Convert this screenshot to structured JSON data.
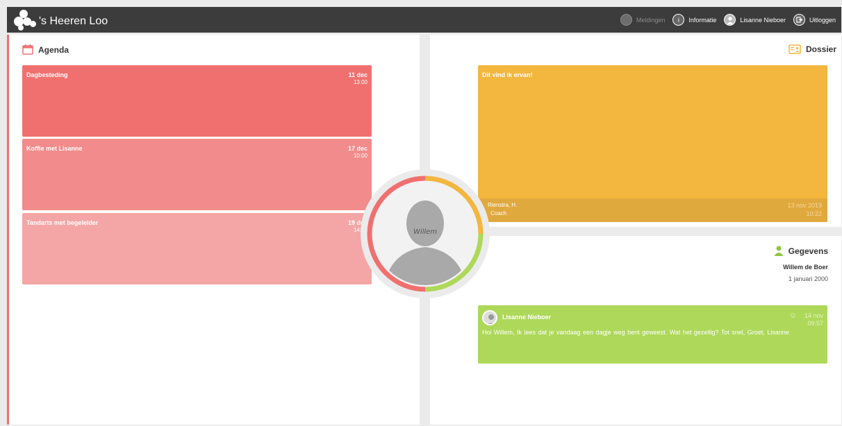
{
  "app": {
    "logo_text": "'s Heeren Loo"
  },
  "nav": {
    "meldingen": "Meldingen",
    "informatie": "Informatie",
    "user": "Lisanne Nieboer",
    "uitloggen": "Uitloggen"
  },
  "agenda": {
    "title": "Agenda",
    "items": [
      {
        "title": "Dagbesteding",
        "date": "11 dec",
        "time": "13:00",
        "color": "#f07070"
      },
      {
        "title": "Koffie met Lisanne",
        "date": "17 dec",
        "time": "10:00",
        "color": "#f28b8b"
      },
      {
        "title": "Tandarts met begeleider",
        "date": "19 dec",
        "time": "14:00",
        "color": "#f4a6a6"
      }
    ]
  },
  "dossier": {
    "title": "Dossier",
    "card_title": "Dit vind ik ervan!",
    "author": "Rienstra, H.",
    "role": "Coach",
    "date": "13 nov 2019",
    "time": "10:22",
    "color": "#f3b63e"
  },
  "gegevens": {
    "title": "Gegevens",
    "name": "Willem de Boer",
    "birthdate": "1 januari 2000"
  },
  "message": {
    "sender": "Lisanne Nieboer",
    "date": "14 nov",
    "time": "09:57",
    "body": "Hoi Willem,    Ik lees dat je vandaag een dagje weg bent geweest. Wat het gezellig?    Tot snel,    Groet, Lisanne",
    "color": "#aed85a"
  },
  "profile": {
    "name": "Willem",
    "ring_colors": [
      "#f3b63e",
      "#aed85a",
      "#f07070"
    ]
  }
}
